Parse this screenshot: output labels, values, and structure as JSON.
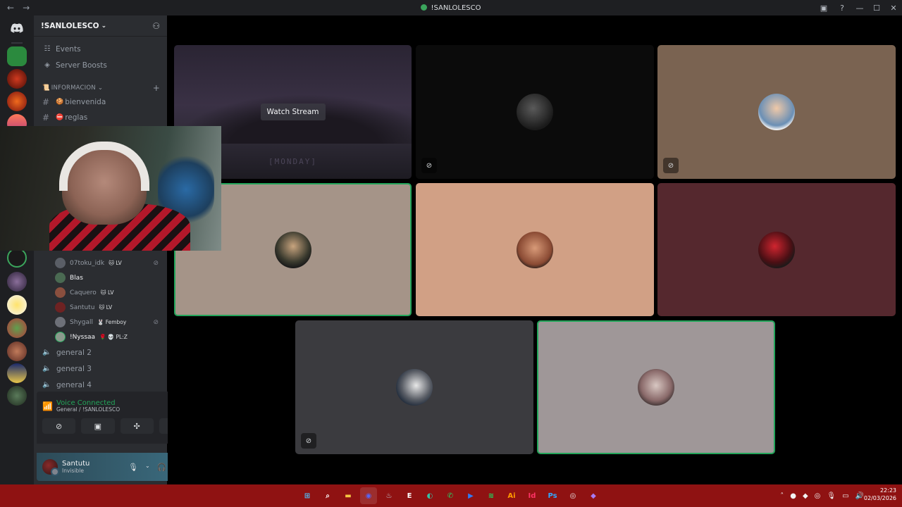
{
  "window": {
    "title": "!SANLOLESCO",
    "back_glyph": "←",
    "forward_glyph": "→",
    "inbox_icon": "inbox-icon",
    "help_icon": "help-icon"
  },
  "server": {
    "name": "!SANLOLESCO",
    "nav": [
      {
        "icon": "☷",
        "label": "Events"
      },
      {
        "icon": "◈",
        "label": "Server Boosts"
      }
    ],
    "category": "INFORMACION",
    "text_channels": [
      {
        "emoji": "🍪",
        "name": "bienvenida"
      },
      {
        "emoji": "⛔",
        "name": "reglas"
      }
    ],
    "voice_users": [
      {
        "name": "07toku_idk",
        "tag": "🐱 LV",
        "muted": true,
        "color": "#5a5e66"
      },
      {
        "name": "Blas",
        "tag": "",
        "muted": false,
        "color": "#4a6a52",
        "bright": true
      },
      {
        "name": "Caquero",
        "tag": "🐱 LV",
        "muted": false,
        "color": "#8a4f3e"
      },
      {
        "name": "Santutu",
        "tag": "🐱 LV",
        "muted": false,
        "color": "#6e2222"
      },
      {
        "name": "Shygall",
        "tag": "🐰 Femboy",
        "muted": true,
        "color": "#6d7078"
      },
      {
        "name": "!Nyssaa",
        "tag": "🌹   💀 PL:Z",
        "muted": false,
        "color": "#8b9a8d",
        "bright": true
      }
    ],
    "voice_channels": [
      "general 2",
      "general 3",
      "general 4"
    ]
  },
  "voice": {
    "status": "Voice Connected",
    "location": "General / !SANLOLESCO"
  },
  "user": {
    "name": "Santutu",
    "status": "Invisible"
  },
  "stage": {
    "watch_stream_label": "Watch Stream",
    "stream_overlay_text": "[MONDAY]"
  },
  "taskbar": {
    "time": "22:23",
    "date": "02/03/2026",
    "apps": [
      {
        "name": "start",
        "glyph": "⊞",
        "color": "#4cc2ff"
      },
      {
        "name": "search",
        "glyph": "⌕",
        "color": "#ffffff"
      },
      {
        "name": "file-explorer",
        "glyph": "▬",
        "color": "#f5c542"
      },
      {
        "name": "discord",
        "glyph": "◉",
        "color": "#5865f2",
        "active": true
      },
      {
        "name": "steam",
        "glyph": "♨",
        "color": "#c7d5e0"
      },
      {
        "name": "epic-games",
        "glyph": "E",
        "color": "#ffffff"
      },
      {
        "name": "edge",
        "glyph": "◐",
        "color": "#35c0a5"
      },
      {
        "name": "whatsapp",
        "glyph": "✆",
        "color": "#25d366"
      },
      {
        "name": "app-blue",
        "glyph": "▶",
        "color": "#2f7bf5"
      },
      {
        "name": "spotify",
        "glyph": "≋",
        "color": "#1ed760"
      },
      {
        "name": "illustrator",
        "glyph": "Ai",
        "color": "#ff9a00"
      },
      {
        "name": "indesign",
        "glyph": "Id",
        "color": "#ff3366"
      },
      {
        "name": "photoshop",
        "glyph": "Ps",
        "color": "#31a8ff"
      },
      {
        "name": "chrome",
        "glyph": "◎",
        "color": "#e8e8e8"
      },
      {
        "name": "app-purple",
        "glyph": "◆",
        "color": "#a77bf3"
      }
    ]
  }
}
